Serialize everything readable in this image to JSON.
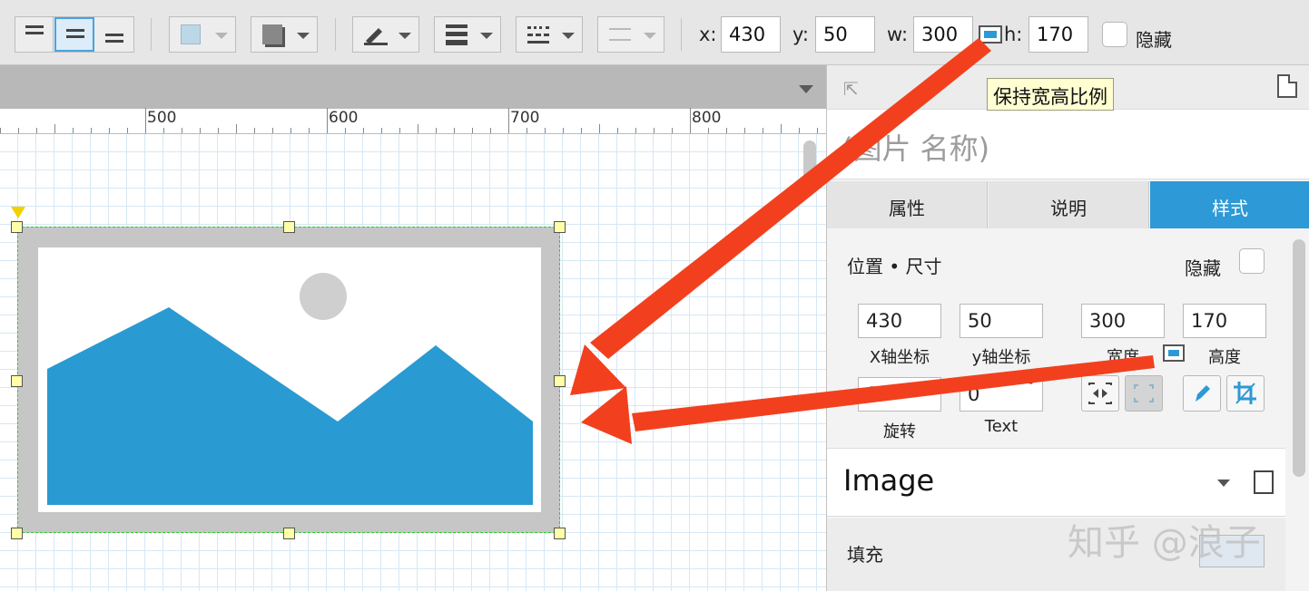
{
  "toolbar": {
    "x_label": "x:",
    "x_value": "430",
    "y_label": "y:",
    "y_value": "50",
    "w_label": "w:",
    "w_value": "300",
    "h_label": "h:",
    "h_value": "170",
    "hide_label": "隐藏"
  },
  "tooltip": {
    "text": "保持宽高比例"
  },
  "ruler": {
    "labels": [
      "500",
      "600",
      "700",
      "800"
    ]
  },
  "panel": {
    "name_placeholder": "(图片 名称)",
    "tabs": [
      {
        "label": "属性",
        "active": false
      },
      {
        "label": "说明",
        "active": false
      },
      {
        "label": "样式",
        "active": true
      }
    ],
    "section_title": "位置 • 尺寸",
    "hide_label": "隐藏",
    "fields": {
      "x": {
        "value": "430",
        "label": "X轴坐标"
      },
      "y": {
        "value": "50",
        "label": "y轴坐标"
      },
      "w": {
        "value": "300",
        "label": "宽度"
      },
      "h": {
        "value": "170",
        "label": "高度"
      },
      "rotate": {
        "value": "0",
        "label": "旋转"
      },
      "text_rotate": {
        "value": "0",
        "label": "Text",
        "unit": "°"
      }
    },
    "image_label": "Image",
    "fill_label": "填充"
  },
  "watermark": "知乎 @浪子",
  "colors": {
    "accent": "#2d99d6",
    "arrow": "#f2401f",
    "selection": "#2bd02b"
  }
}
